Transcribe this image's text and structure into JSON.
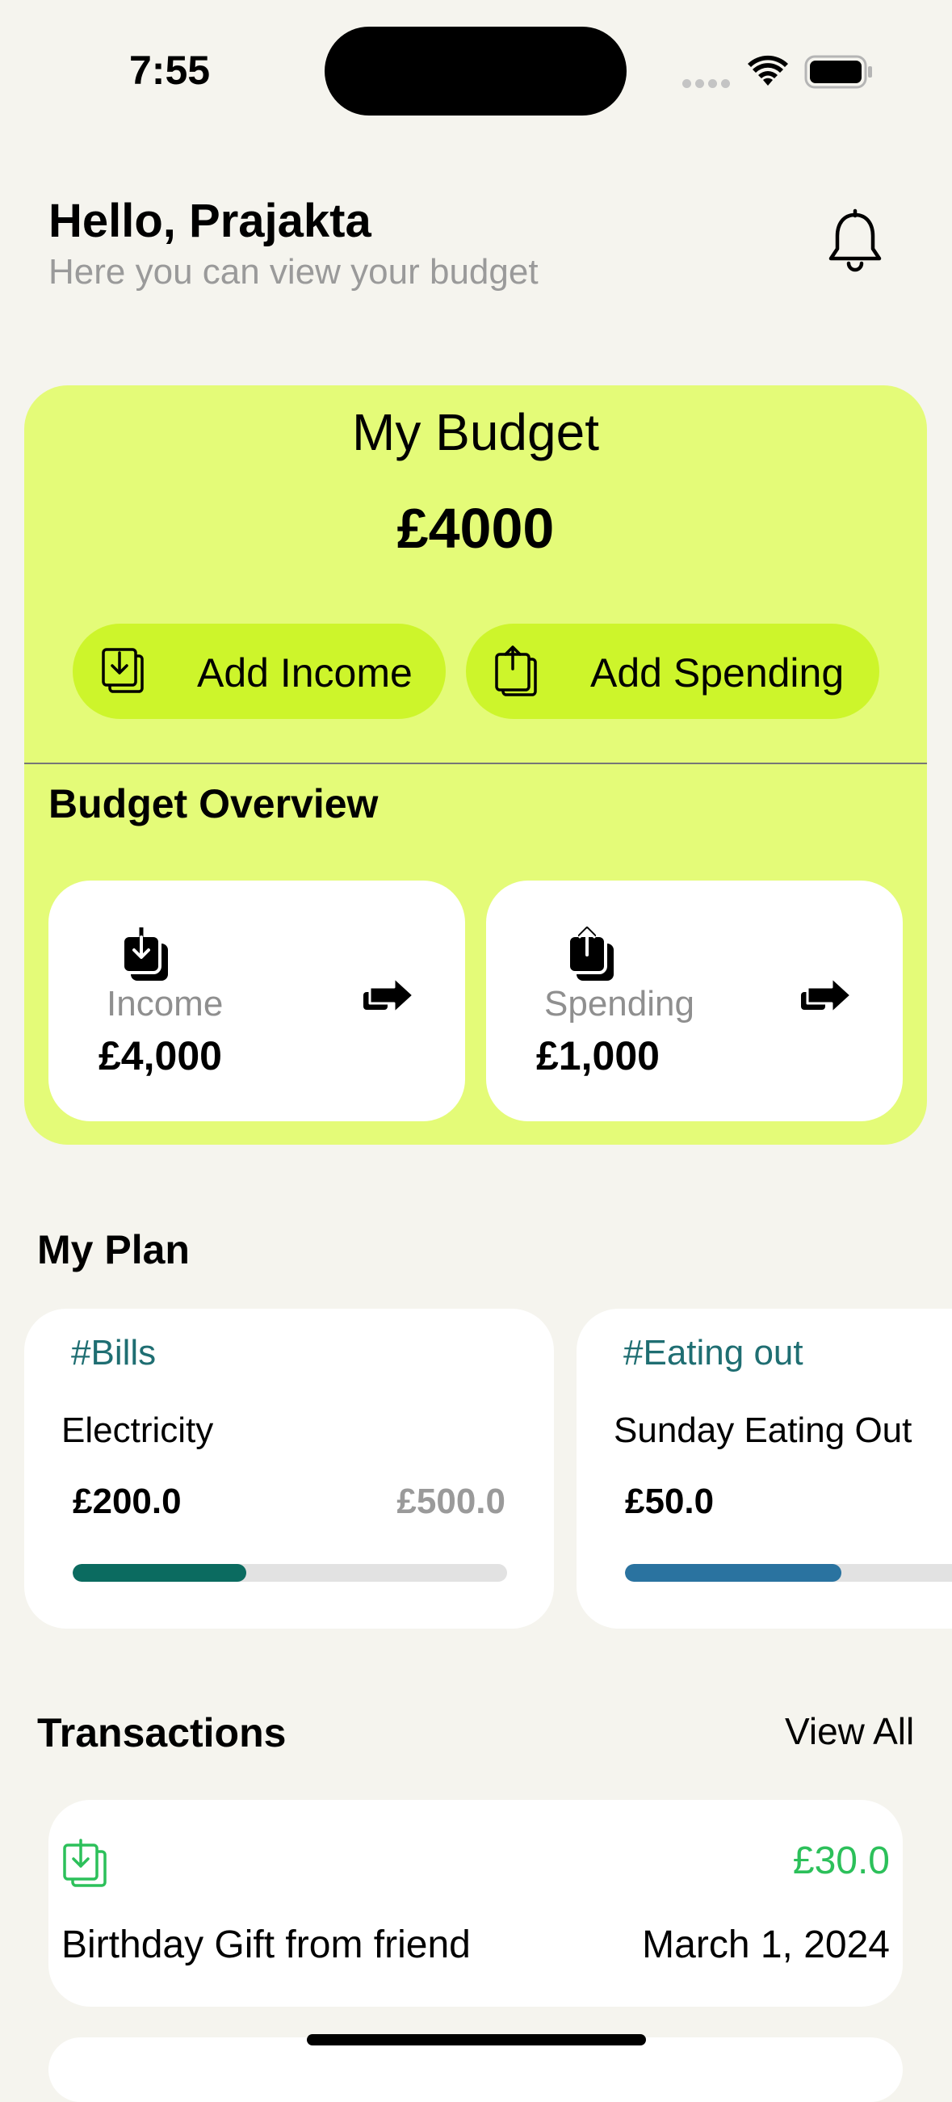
{
  "status_bar": {
    "time": "7:55"
  },
  "header": {
    "greeting": "Hello, Prajakta",
    "subtitle": "Here you can view your budget"
  },
  "budget": {
    "title": "My Budget",
    "amount": "£4000",
    "add_income_label": "Add Income",
    "add_spending_label": "Add Spending",
    "overview_title": "Budget Overview",
    "income": {
      "label": "Income",
      "amount": "£4,000"
    },
    "spending": {
      "label": "Spending",
      "amount": "£1,000"
    }
  },
  "plan": {
    "title": "My Plan",
    "items": [
      {
        "tag": "#Bills",
        "name": "Electricity",
        "spent": "£200.0",
        "limit": "£500.0",
        "progress": 0.4,
        "color": "#0b6b60"
      },
      {
        "tag": "#Eating out",
        "name": "Sunday Eating Out",
        "spent": "£50.0",
        "progress": 0.61,
        "color": "#2a73a0"
      }
    ]
  },
  "transactions": {
    "title": "Transactions",
    "view_all": "View All",
    "items": [
      {
        "amount": "£30.0",
        "description": "Birthday Gift from friend",
        "date": "March 1, 2024",
        "color": "#2cc05a"
      }
    ]
  },
  "icons": [
    "bell-icon",
    "income-icon",
    "spending-icon",
    "arrow-right-icon",
    "wifi-icon",
    "battery-icon"
  ]
}
